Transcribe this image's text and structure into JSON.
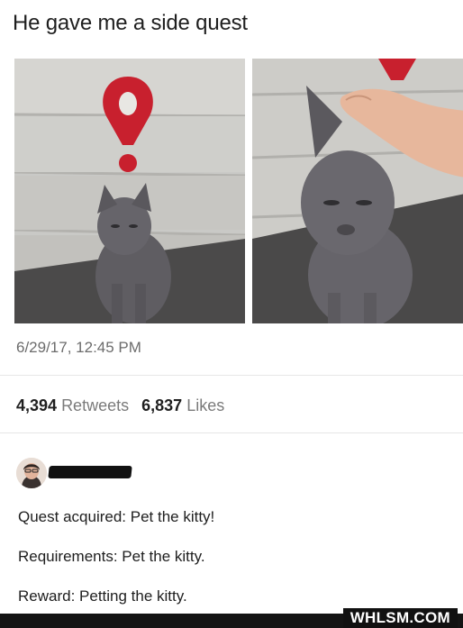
{
  "post": {
    "title": "He gave me a side quest",
    "timestamp": "6/29/17, 12:45 PM",
    "retweets_count": "4,394",
    "retweets_label": "Retweets",
    "likes_count": "6,837",
    "likes_label": "Likes"
  },
  "reply": {
    "lines": [
      "Quest acquired: Pet the kitty!",
      "Requirements: Pet the kitty.",
      "Reward: Petting the kitty."
    ]
  },
  "watermark": "WHLSM.COM",
  "colors": {
    "quest_marker": "#c8202e",
    "cat": "#5d5b60"
  }
}
